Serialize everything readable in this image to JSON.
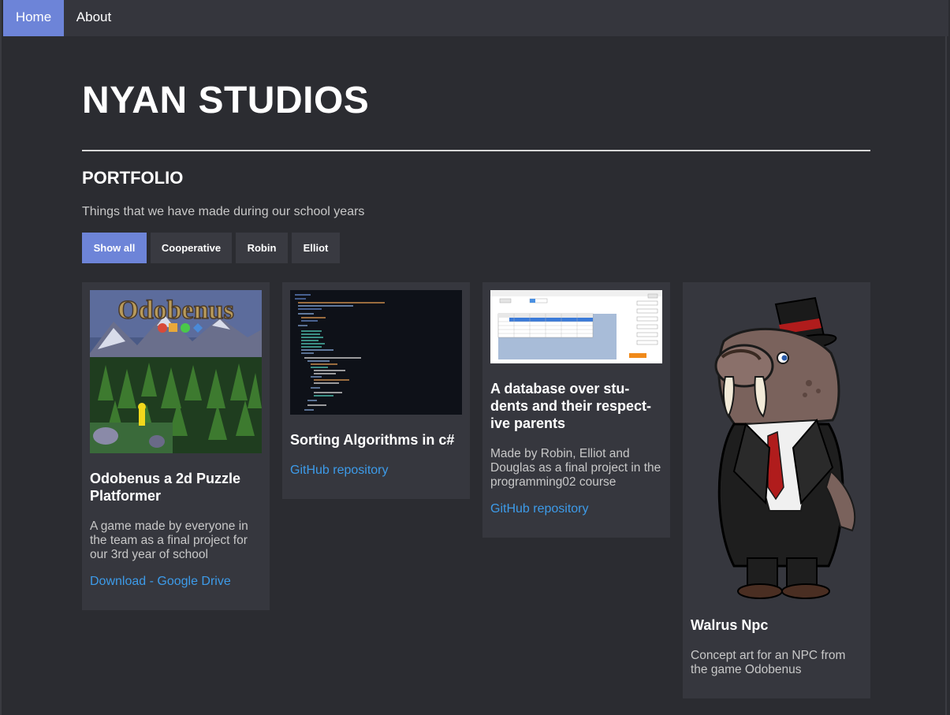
{
  "nav": {
    "home": "Home",
    "about": "About"
  },
  "header": {
    "title": "NYAN STUDIOS"
  },
  "portfolio": {
    "title": "PORTFOLIO",
    "subtitle": "Things that we have made during our school years",
    "filters": [
      "Show all",
      "Cooperative",
      "Robin",
      "Elliot"
    ],
    "active_filter": "Show all"
  },
  "cards": [
    {
      "image_label": "Odobenus",
      "title": "Odobenus a 2d Puzzle Platformer",
      "description": "A game made by everyone in the team as a final project for our 3rd year of school",
      "link": "Download - Google Drive"
    },
    {
      "title": "Sorting Algorithms in c#",
      "link": "GitHub repository"
    },
    {
      "title": "A database over stu-dents and their respect-ive parents",
      "title_lines": [
        "A database over stu-",
        "dents and their respect-",
        "ive parents"
      ],
      "description": "Made by Robin, Elliot and Douglas as a final project in the programming02 course",
      "link": "GitHub repository"
    },
    {
      "title": "Walrus Npc",
      "description": "Concept art for an NPC from the game Odobenus"
    }
  ],
  "colors": {
    "background": "#2b2c31",
    "navbar": "#35363d",
    "accent": "#6d84d8",
    "card": "#36373e",
    "link": "#3d9be9",
    "muted_text": "#c8c8c8"
  }
}
